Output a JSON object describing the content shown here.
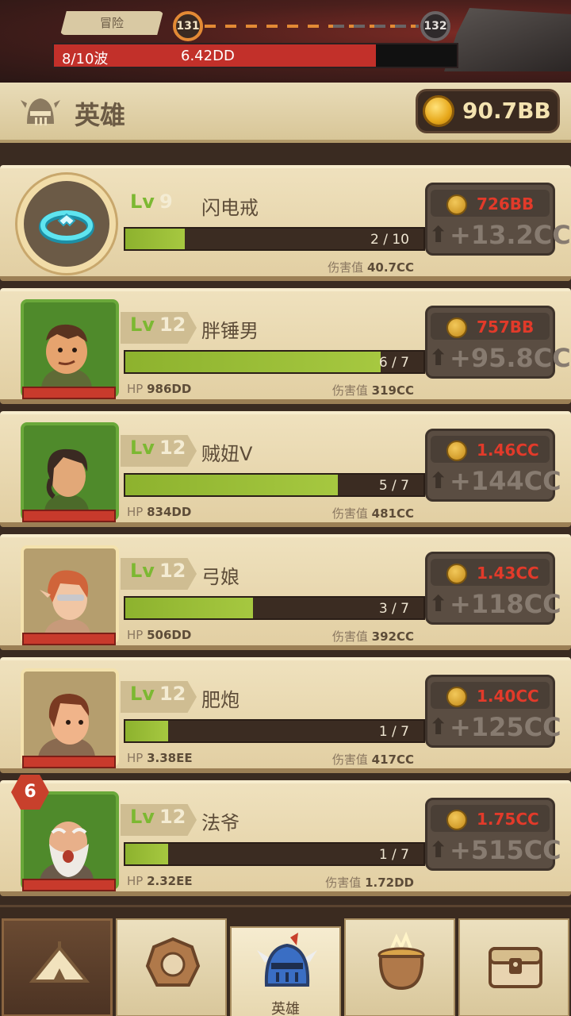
{
  "adventure": {
    "tag": "冒险",
    "current_level": "131",
    "next_level": "132",
    "wave_text": "8/10波",
    "wave_progress": 0.8,
    "boss_hp": "6.42DD"
  },
  "header": {
    "title": "英雄",
    "gold": "90.7BB",
    "icon": "helmet-icon"
  },
  "items": [
    {
      "type": "ring",
      "lv_label": "Lv",
      "level": "9",
      "name": "闪电戒",
      "xp": "2 / 10",
      "xp_fraction": 0.2,
      "hp_label": "",
      "hp": "",
      "dmg_label": "伤害值",
      "dmg": "40.7CC",
      "cost": "726BB",
      "gain": "+13.2CC"
    },
    {
      "type": "hero",
      "lv_label": "Lv",
      "level": "12",
      "name": "胖锤男",
      "xp": "6 / 7",
      "xp_fraction": 0.857,
      "hp_label": "HP",
      "hp": "986DD",
      "dmg_label": "伤害值",
      "dmg": "319CC",
      "cost": "757BB",
      "gain": "+95.8CC"
    },
    {
      "type": "hero",
      "lv_label": "Lv",
      "level": "12",
      "name": "贼妞V",
      "xp": "5 / 7",
      "xp_fraction": 0.714,
      "hp_label": "HP",
      "hp": "834DD",
      "dmg_label": "伤害值",
      "dmg": "481CC",
      "cost": "1.46CC",
      "gain": "+144CC"
    },
    {
      "type": "hero",
      "lv_label": "Lv",
      "level": "12",
      "name": "弓娘",
      "xp": "3 / 7",
      "xp_fraction": 0.428,
      "hp_label": "HP",
      "hp": "506DD",
      "dmg_label": "伤害值",
      "dmg": "392CC",
      "cost": "1.43CC",
      "gain": "+118CC"
    },
    {
      "type": "hero",
      "lv_label": "Lv",
      "level": "12",
      "name": "肥炮",
      "xp": "1 / 7",
      "xp_fraction": 0.143,
      "hp_label": "HP",
      "hp": "3.38EE",
      "dmg_label": "伤害值",
      "dmg": "417CC",
      "cost": "1.40CC",
      "gain": "+125CC"
    },
    {
      "type": "hero",
      "lv_label": "Lv",
      "level": "12",
      "name": "法爷",
      "xp": "1 / 7",
      "xp_fraction": 0.143,
      "hp_label": "HP",
      "hp": "2.32EE",
      "dmg_label": "伤害值",
      "dmg": "1.72DD",
      "cost": "1.75CC",
      "gain": "+515CC",
      "badge": "6"
    }
  ],
  "nav": {
    "active_label": "英雄",
    "tabs": [
      "camp-icon",
      "relic-icon",
      "hero-helmet-icon",
      "cauldron-icon",
      "treasure-chest-icon"
    ]
  },
  "colors": {
    "xp_fill": "#8db22e",
    "cost_red": "#e23a2a",
    "level_green": "#7cb832",
    "wave_red": "#c2302a"
  }
}
